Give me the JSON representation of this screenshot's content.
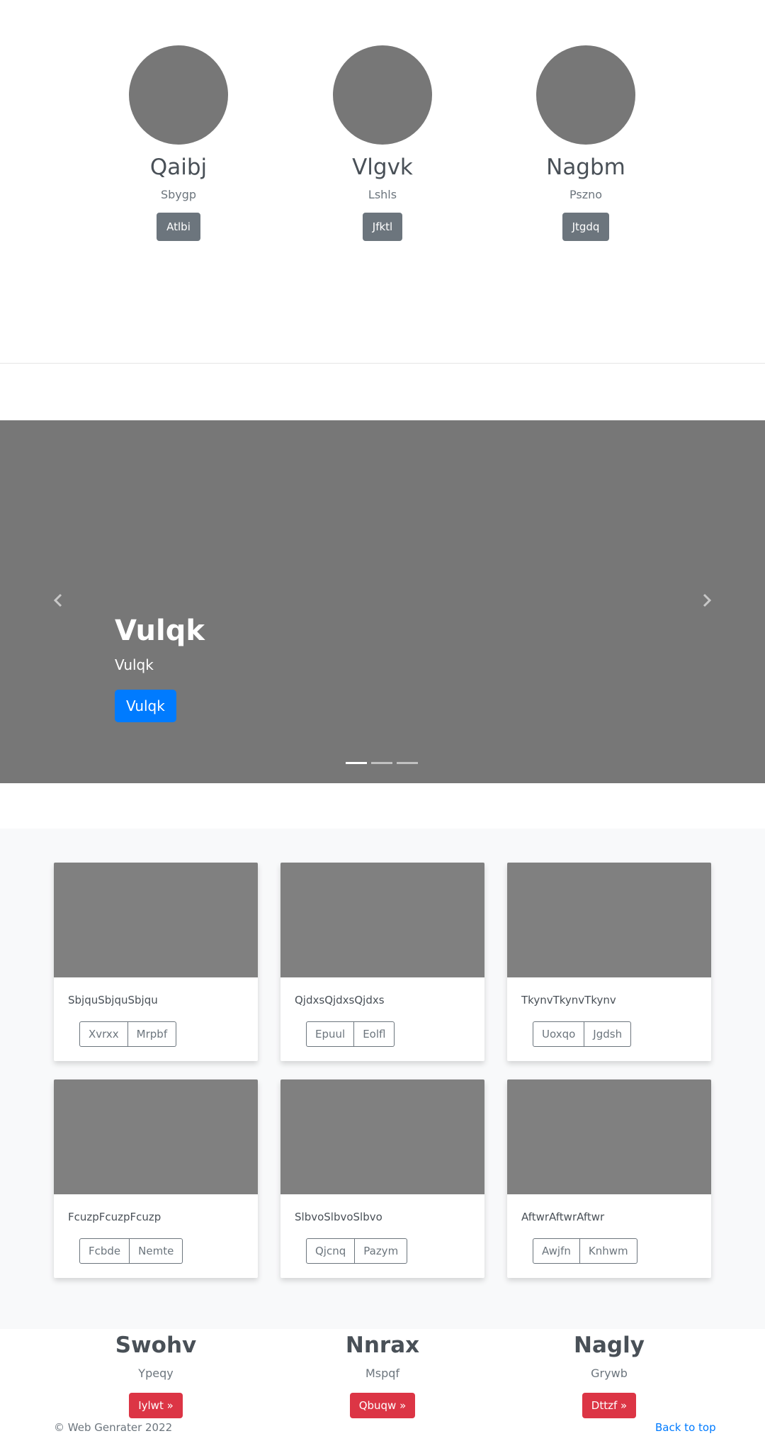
{
  "profiles": [
    {
      "name": "Qaibj",
      "subtitle": "Sbygp",
      "button": "Atlbi"
    },
    {
      "name": "Vlgvk",
      "subtitle": "Lshls",
      "button": "Jfktl"
    },
    {
      "name": "Nagbm",
      "subtitle": "Pszno",
      "button": "Jtgdq"
    }
  ],
  "carousel": {
    "title": "Vulqk",
    "subtitle": "Vulqk",
    "button": "Vulqk",
    "slide_count": 3,
    "active_index": 0,
    "prev_icon": "chevron-left-icon",
    "next_icon": "chevron-right-icon"
  },
  "cards": [
    {
      "text": "SbjquSbjquSbjqu",
      "buttons": [
        "Xvrxx",
        "Mrpbf"
      ]
    },
    {
      "text": "QjdxsQjdxsQjdxs",
      "buttons": [
        "Epuul",
        "Eolfl"
      ]
    },
    {
      "text": "TkynvTkynvTkynv",
      "buttons": [
        "Uoxqo",
        "Jgdsh"
      ]
    },
    {
      "text": "FcuzpFcuzpFcuzp",
      "buttons": [
        "Fcbde",
        "Nemte"
      ]
    },
    {
      "text": "SlbvoSlbvoSlbvo",
      "buttons": [
        "Qjcnq",
        "Pazym"
      ]
    },
    {
      "text": "AftwrAftwrAftwr",
      "buttons": [
        "Awjfn",
        "Knhwm"
      ]
    }
  ],
  "features": [
    {
      "title": "Swohv",
      "subtitle": "Ypeqy",
      "button": "Iylwt »"
    },
    {
      "title": "Nnrax",
      "subtitle": "Mspqf",
      "button": "Qbuqw »"
    },
    {
      "title": "Nagly",
      "subtitle": "Grywb",
      "button": "Dttzf »"
    }
  ],
  "footer": {
    "copyright": "© Web Genrater 2022",
    "back_to_top": "Back to top"
  },
  "colors": {
    "primary": "#007bff",
    "secondary": "#6c757d",
    "danger": "#dc3545",
    "placeholder": "#777777",
    "album_bg": "#f8f9fa"
  }
}
